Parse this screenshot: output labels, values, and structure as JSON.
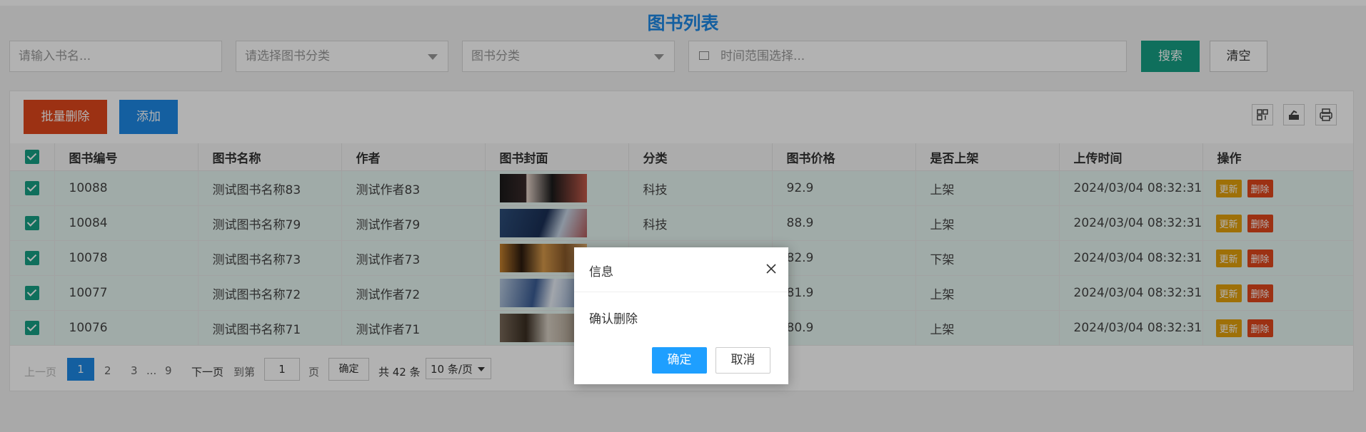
{
  "page": {
    "title": "图书列表"
  },
  "search": {
    "name_placeholder": "请输入书名...",
    "category_placeholder": "请选择图书分类",
    "category2_placeholder": "图书分类",
    "time_placeholder": "时间范围选择...",
    "search_label": "搜索",
    "clear_label": "清空"
  },
  "toolbar": {
    "batch_delete_label": "批量删除",
    "add_label": "添加"
  },
  "table": {
    "columns": [
      "图书编号",
      "图书名称",
      "作者",
      "图书封面",
      "分类",
      "图书价格",
      "是否上架",
      "上传时间",
      "操作"
    ],
    "rows": [
      {
        "id": "10088",
        "name": "测试图书名称83",
        "author": "测试作者83",
        "category": "科技",
        "price": "92.9",
        "status": "上架",
        "time": "2024/03/04 08:32:31"
      },
      {
        "id": "10084",
        "name": "测试图书名称79",
        "author": "测试作者79",
        "category": "科技",
        "price": "88.9",
        "status": "上架",
        "time": "2024/03/04 08:32:31"
      },
      {
        "id": "10078",
        "name": "测试图书名称73",
        "author": "测试作者73",
        "category": "",
        "price": "82.9",
        "status": "下架",
        "time": "2024/03/04 08:32:31"
      },
      {
        "id": "10077",
        "name": "测试图书名称72",
        "author": "测试作者72",
        "category": "",
        "price": "81.9",
        "status": "上架",
        "time": "2024/03/04 08:32:31"
      },
      {
        "id": "10076",
        "name": "测试图书名称71",
        "author": "测试作者71",
        "category": "",
        "price": "80.9",
        "status": "上架",
        "time": "2024/03/04 08:32:31"
      }
    ],
    "update_label": "更新",
    "delete_label": "删除"
  },
  "pager": {
    "prev": "上一页",
    "pages": [
      "1",
      "2",
      "3"
    ],
    "ellipsis": "...",
    "last_page": "9",
    "next": "下一页",
    "goto_label": "到第",
    "goto_value": "1",
    "page_unit": "页",
    "confirm": "确定",
    "total": "共 42 条",
    "per_page": "10 条/页"
  },
  "dialog": {
    "title": "信息",
    "message": "确认删除",
    "ok_label": "确定",
    "cancel_label": "取消"
  },
  "colors": {
    "accent_blue": "#1e88e5",
    "teal": "#16a085",
    "danger": "#e0471c",
    "warning": "#e2a10c"
  },
  "icons": [
    "columns-icon",
    "export-icon",
    "print-icon",
    "calendar-icon",
    "close-icon"
  ]
}
